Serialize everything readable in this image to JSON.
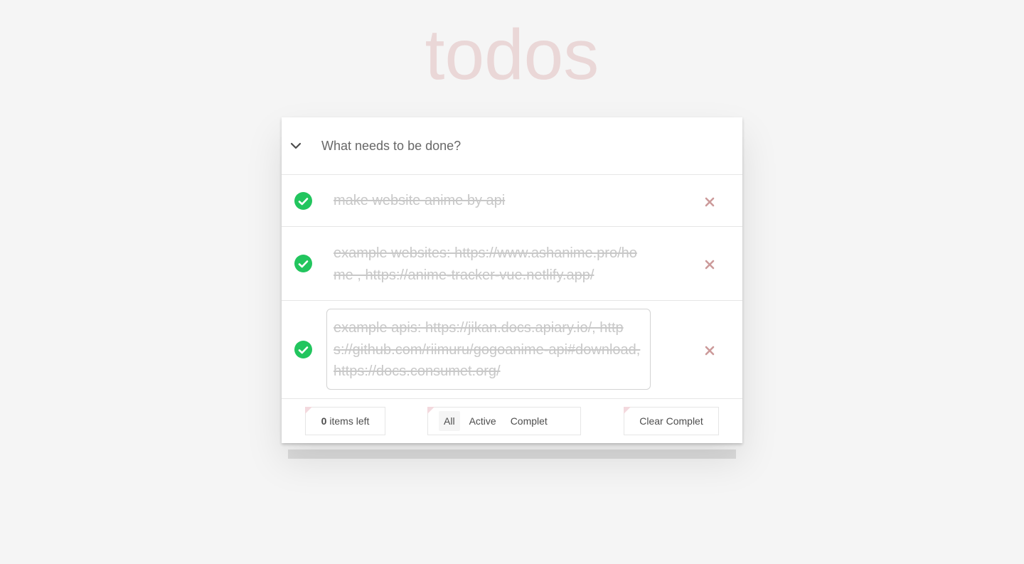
{
  "header": {
    "title": "todos",
    "input_placeholder": "What needs to be done?",
    "toggle_all_icon": "chevron-down-icon"
  },
  "todos": [
    {
      "text": "make website anime by api",
      "completed": true,
      "editing": false
    },
    {
      "text": "example websites: https://www.ashanime.pro/home , https://anime-tracker-vue.netlify.app/",
      "completed": true,
      "editing": false
    },
    {
      "text": "example apis: https://jikan.docs.apiary.io/, https://github.com/riimuru/gogoanime-api#download, https://docs.consumet.org/",
      "completed": true,
      "editing": true
    }
  ],
  "footer": {
    "count": "0",
    "count_suffix": "items left",
    "filters": [
      "All",
      "Active",
      "Complet"
    ],
    "selected_filter": "All",
    "clear_label": "Clear Complet"
  },
  "colors": {
    "background": "#f5f5f5",
    "title": "#ead7d7",
    "check": "#22c55e",
    "delete": "#cc9a9a",
    "completed_text": "#c8c8c8"
  }
}
